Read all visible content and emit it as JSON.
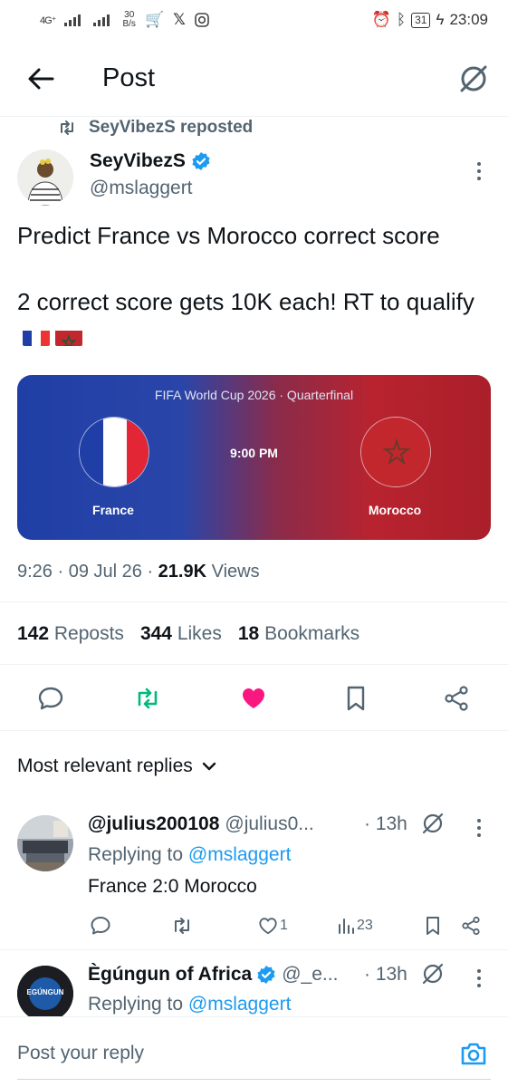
{
  "status_bar": {
    "network": "4G⁺",
    "speed_value": "30",
    "speed_unit": "B/s",
    "battery": "31",
    "time": "23:09"
  },
  "header": {
    "title": "Post"
  },
  "repost": {
    "text": "SeyVibezS reposted"
  },
  "author": {
    "name": "SeyVibezS",
    "handle": "@mslaggert"
  },
  "tweet": {
    "line1": "Predict France vs Morocco correct score",
    "line2": "2 correct score gets 10K each! RT to qualify"
  },
  "match_card": {
    "competition": "FIFA World Cup 2026 · Quarterfinal",
    "kickoff": "9:00 PM",
    "home": "France",
    "away": "Morocco"
  },
  "meta": {
    "time": "9:26",
    "date": "09 Jul 26",
    "views_count": "21.9K",
    "views_label": "Views"
  },
  "stats": {
    "reposts_count": "142",
    "reposts_label": "Reposts",
    "likes_count": "344",
    "likes_label": "Likes",
    "bookmarks_count": "18",
    "bookmarks_label": "Bookmarks"
  },
  "replies_header": "Most relevant replies",
  "replies": [
    {
      "name": "@julius200108",
      "handle": "@julius0...",
      "time": "· 13h",
      "replying_prefix": "Replying to",
      "replying_to": "@mslaggert",
      "text": "France 2:0 Morocco",
      "likes": "1",
      "views": "23"
    },
    {
      "name": "Ègúngun of Africa",
      "handle": "@_e...",
      "time": "· 13h",
      "replying_prefix": "Replying to",
      "replying_to": "@mslaggert",
      "avatar_text": "EGÚNGUN"
    }
  ],
  "composer": {
    "placeholder": "Post your reply"
  },
  "colors": {
    "accent": "#1d9bf0",
    "repost_green": "#00ba7c",
    "like_pink": "#f91880",
    "france_blue": "#1f3fa6",
    "morocco_red": "#b8232f"
  }
}
